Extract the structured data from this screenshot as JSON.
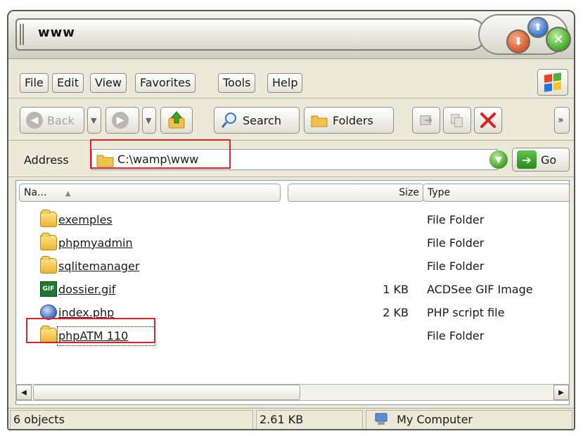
{
  "window": {
    "title": "www"
  },
  "title_buttons": {
    "minimize_glyph": "⬇",
    "maximize_glyph": "⬆",
    "close_glyph": "✕"
  },
  "menu": [
    {
      "label": "File",
      "name": "menu-file"
    },
    {
      "label": "Edit",
      "name": "menu-edit"
    },
    {
      "label": "View",
      "name": "menu-view"
    },
    {
      "label": "Favorites",
      "name": "menu-favorites"
    },
    {
      "label": "Tools",
      "name": "menu-tools"
    },
    {
      "label": "Help",
      "name": "menu-help"
    }
  ],
  "toolbar": {
    "back_label": "Back",
    "search_label": "Search",
    "folders_label": "Folders",
    "overflow_glyph": "»"
  },
  "address": {
    "label": "Address",
    "value": "C:\\wamp\\www",
    "go_label": "Go"
  },
  "columns": {
    "name": "Na...",
    "size": "Size",
    "type": "Type"
  },
  "files": [
    {
      "name": "exemples",
      "size": "",
      "type": "File Folder",
      "icon": "folder-icon"
    },
    {
      "name": "phpmyadmin",
      "size": "",
      "type": "File Folder",
      "icon": "folder-icon"
    },
    {
      "name": "sqlitemanager",
      "size": "",
      "type": "File Folder",
      "icon": "folder-icon"
    },
    {
      "name": "dossier.gif",
      "size": "1 KB",
      "type": "ACDSee GIF Image",
      "icon": "gif-icon"
    },
    {
      "name": "index.php",
      "size": "2 KB",
      "type": "PHP script file",
      "icon": "php-icon"
    },
    {
      "name": "phpATM 110",
      "size": "",
      "type": "File Folder",
      "icon": "folder-icon"
    }
  ],
  "gif_badge": "GIF",
  "status": {
    "objects": "6 objects",
    "size": "2.61 KB",
    "zone": "My Computer"
  },
  "colors": {
    "annotation_red": "#e0202a",
    "xp_frame": "#ece9d8"
  }
}
